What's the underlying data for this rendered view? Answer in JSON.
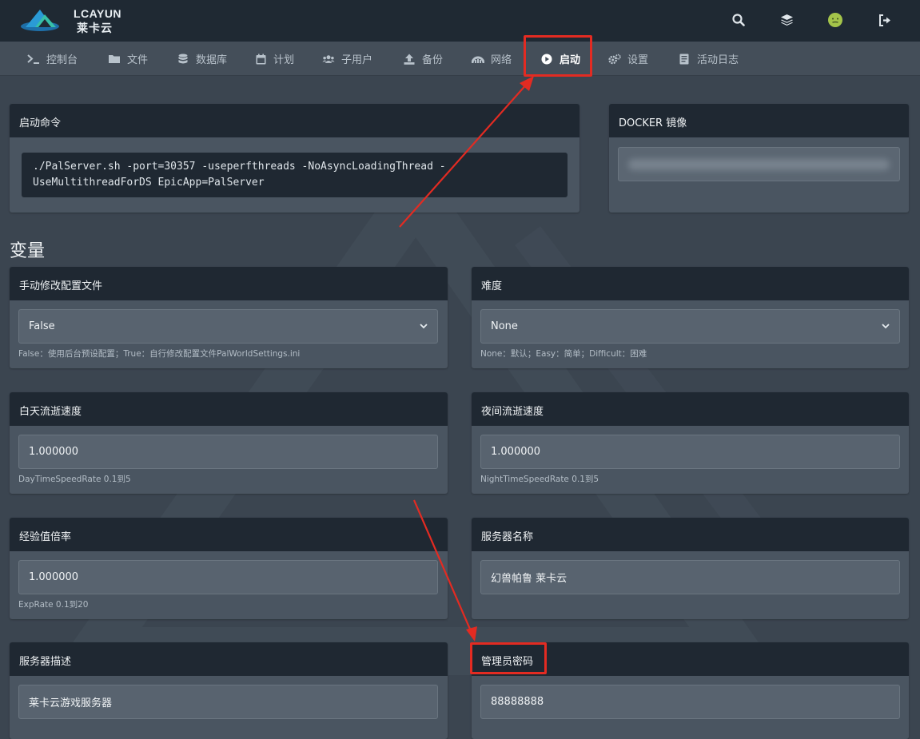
{
  "header": {
    "logo": {
      "text_en": "LCAYUN",
      "text_cn": "莱卡云"
    },
    "icons": [
      "search-icon",
      "layers-icon",
      "avatar-icon",
      "logout-icon"
    ]
  },
  "nav": {
    "items": [
      {
        "label": "控制台",
        "icon": "terminal-icon"
      },
      {
        "label": "文件",
        "icon": "folder-icon"
      },
      {
        "label": "数据库",
        "icon": "database-icon"
      },
      {
        "label": "计划",
        "icon": "calendar-icon"
      },
      {
        "label": "子用户",
        "icon": "users-icon"
      },
      {
        "label": "备份",
        "icon": "upload-icon"
      },
      {
        "label": "网络",
        "icon": "network-icon"
      },
      {
        "label": "启动",
        "icon": "play-icon",
        "active": true
      },
      {
        "label": "设置",
        "icon": "gears-icon"
      },
      {
        "label": "活动日志",
        "icon": "log-icon"
      }
    ]
  },
  "startup": {
    "title": "启动命令",
    "command_line1": "./PalServer.sh -port=30357 -useperfthreads -NoAsyncLoadingThread -",
    "command_line2": "UseMultithreadForDS EpicApp=PalServer"
  },
  "docker": {
    "title": "DOCKER 镜像"
  },
  "variables": {
    "section_title": "变量",
    "manual_config": {
      "label": "手动修改配置文件",
      "value": "False",
      "hint": "False：使用后台预设配置；True：自行修改配置文件PalWorldSettings.ini"
    },
    "difficulty": {
      "label": "难度",
      "value": "None",
      "hint": "None：默认；Easy：简单；Difficult：困难"
    },
    "day_speed": {
      "label": "白天流逝速度",
      "value": "1.000000",
      "hint": "DayTimeSpeedRate 0.1到5"
    },
    "night_speed": {
      "label": "夜间流逝速度",
      "value": "1.000000",
      "hint": "NightTimeSpeedRate 0.1到5"
    },
    "exp_rate": {
      "label": "经验值倍率",
      "value": "1.000000",
      "hint": "ExpRate 0.1到20"
    },
    "server_name": {
      "label": "服务器名称",
      "value": "幻兽帕鲁 莱卡云"
    },
    "server_desc": {
      "label": "服务器描述",
      "value": "莱卡云游戏服务器"
    },
    "admin_password": {
      "label": "管理员密码",
      "value": "88888888"
    }
  },
  "colors": {
    "annotation_red": "#e32b22",
    "card_header": "#1f2832",
    "card_body": "#4a5561"
  }
}
